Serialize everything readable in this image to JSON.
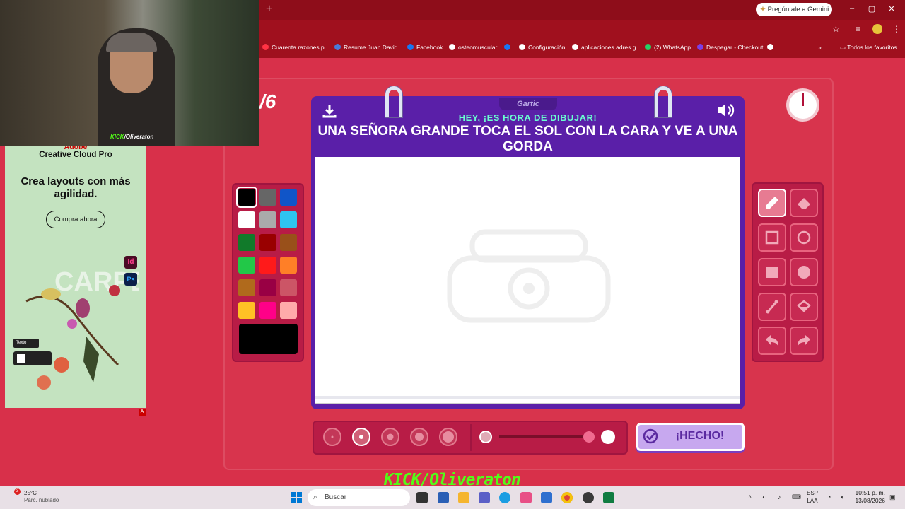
{
  "browser": {
    "new_tab": "+",
    "gemini_button": "Pregúntale a Gemini",
    "window_controls": [
      "–",
      "▢",
      "✕"
    ],
    "bookmarks": [
      {
        "label": "Cuarenta razones p..."
      },
      {
        "label": "Resume Juan David..."
      },
      {
        "label": "Facebook"
      },
      {
        "label": "osteomuscular"
      },
      {
        "label": ""
      },
      {
        "label": "Configuración"
      },
      {
        "label": "aplicaciones.adres.g..."
      },
      {
        "label": "(2) WhatsApp"
      },
      {
        "label": "Despegar - Checkout"
      },
      {
        "label": ""
      }
    ],
    "bookmarks_overflow": "»",
    "all_bookmarks": "Todos los favoritos"
  },
  "webcam": {
    "overlay_brand": "KICK",
    "overlay_handle": "/Oliveraton"
  },
  "ad": {
    "brand": "Adobe",
    "product": "Creative Cloud Pro",
    "headline": "Crea layouts con más agilidad.",
    "cta": "Compra ahora",
    "badge_id": "Id",
    "badge_ps": "Ps",
    "texto_chip": "Texto",
    "adchoices": "A"
  },
  "game": {
    "round_counter": "/6",
    "gartic_tab": "Gartic",
    "subtitle": "HEY, ¡ES HORA DE DIBUJAR!",
    "prompt": "UNA SEÑORA GRANDE TOCA EL SOL CON LA CARA Y VE A UNA GORDA",
    "done_label": "¡HECHO!",
    "palette": [
      "#000000",
      "#666666",
      "#1055c8",
      "#ffffff",
      "#aaaaaa",
      "#2ec4f0",
      "#117a2a",
      "#990000",
      "#99501a",
      "#22c848",
      "#ff1a1a",
      "#ff7f27",
      "#b06a1c",
      "#990044",
      "#cc5566",
      "#ffc125",
      "#ff0088",
      "#ffaaaa"
    ],
    "selected_color": "#000000",
    "tools": [
      "pencil",
      "eraser",
      "rect-outline",
      "circle-outline",
      "rect-fill",
      "circle-fill",
      "line",
      "fill-bucket",
      "undo",
      "redo"
    ],
    "active_tool": "pencil",
    "brush_sizes": 5,
    "selected_size_index": 1
  },
  "stream": {
    "kick_brand": "KICK",
    "handle": "/Oliveraton"
  },
  "taskbar": {
    "weather_temp": "25°C",
    "weather_desc": "Parc. nublado",
    "weather_badge": "3",
    "search_placeholder": "Buscar",
    "lang_line1": "ESP",
    "lang_line2": "LAA",
    "time": "10:51 p. m.",
    "date": "13/08/2026"
  }
}
